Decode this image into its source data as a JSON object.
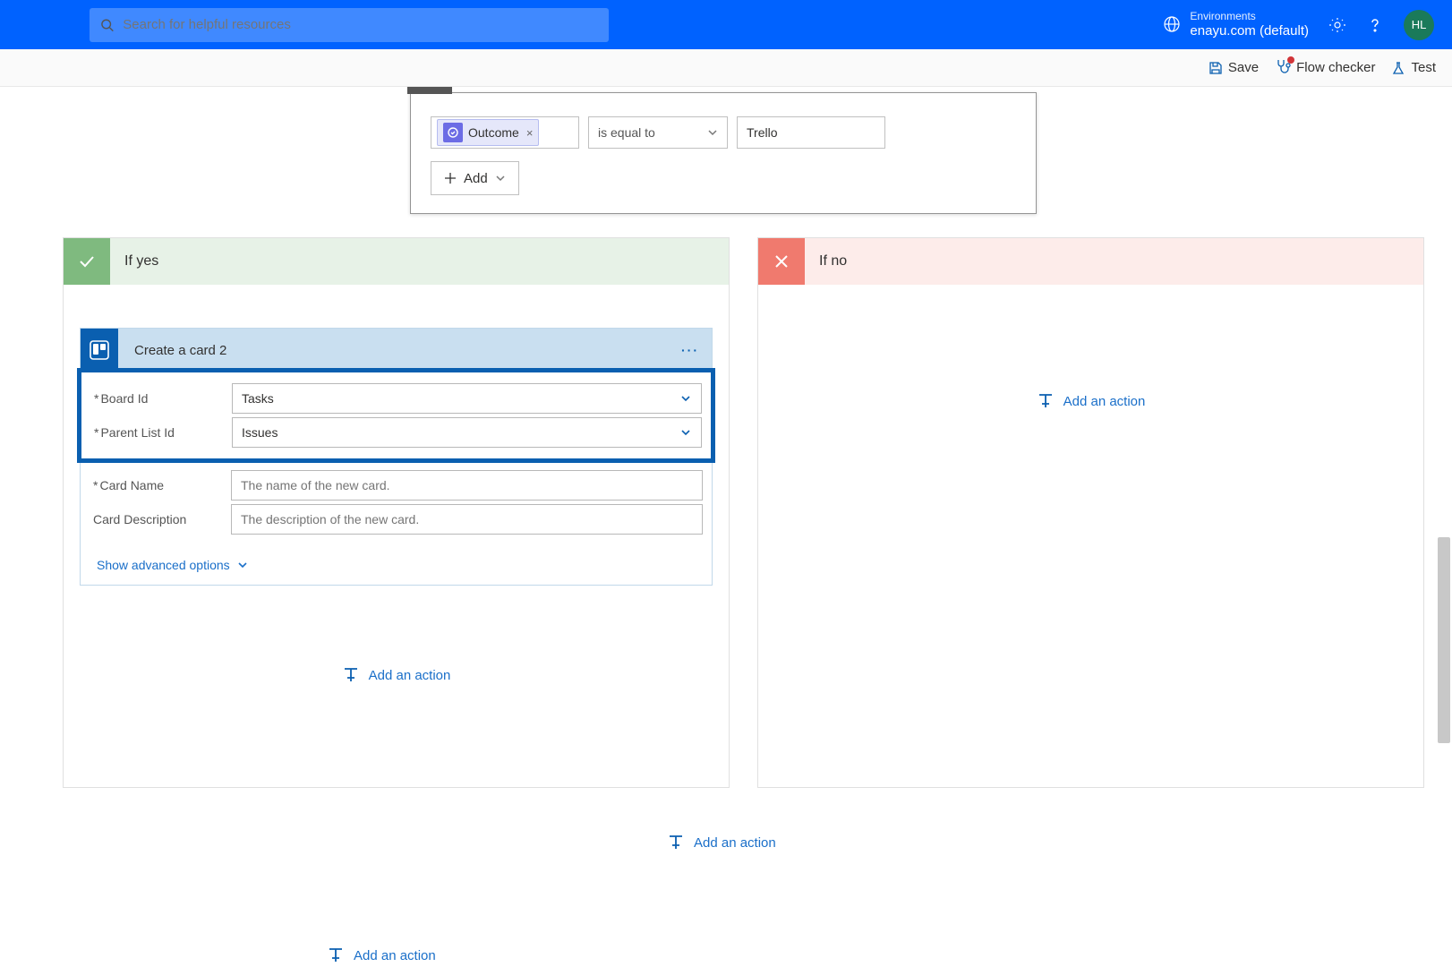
{
  "header": {
    "search_placeholder": "Search for helpful resources",
    "env_label": "Environments",
    "env_name": "enayu.com (default)",
    "avatar_initials": "HL"
  },
  "toolbar": {
    "save": "Save",
    "flow_checker": "Flow checker",
    "test": "Test"
  },
  "condition": {
    "token_label": "Outcome",
    "operator": "is equal to",
    "value": "Trello",
    "add_label": "Add"
  },
  "branches": {
    "yes_title": "If yes",
    "no_title": "If no",
    "add_action": "Add an action"
  },
  "action": {
    "title": "Create a card 2",
    "fields": {
      "board_id_label": "Board Id",
      "board_id_value": "Tasks",
      "parent_list_id_label": "Parent List Id",
      "parent_list_id_value": "Issues",
      "card_name_label": "Card Name",
      "card_name_placeholder": "The name of the new card.",
      "card_desc_label": "Card Description",
      "card_desc_placeholder": "The description of the new card."
    },
    "advanced_link": "Show advanced options"
  }
}
